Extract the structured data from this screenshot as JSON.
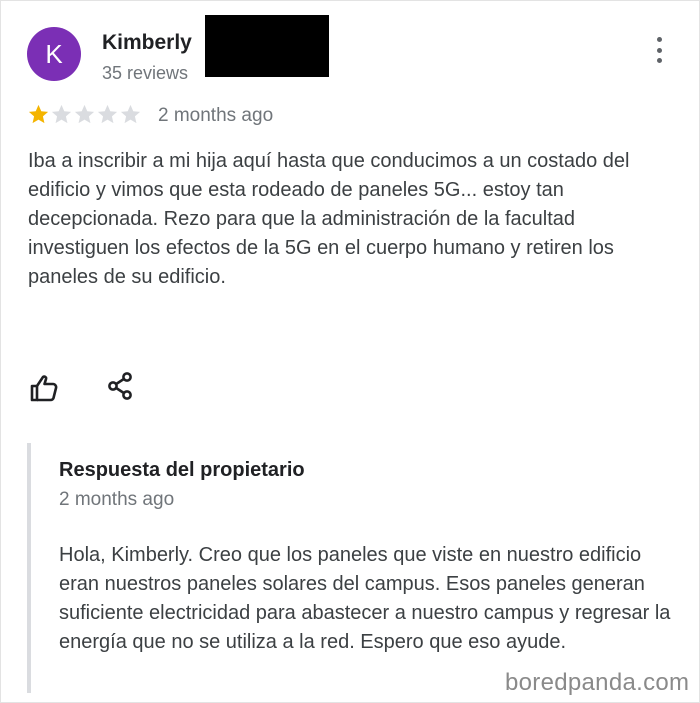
{
  "review": {
    "avatar_letter": "K",
    "avatar_color": "#7b2fb5",
    "author_name": "Kimberly",
    "author_meta": "35 reviews",
    "rating": 1,
    "rating_max": 5,
    "time": "2 months ago",
    "text": "Iba a inscribir a mi hija aquí hasta que conducimos a un costado del edificio y vimos que esta rodeado de paneles 5G... estoy tan decepcionada. Rezo para que la administración de la facultad investiguen los efectos de la 5G en el cuerpo humano y retiren los paneles de su edificio."
  },
  "actions": {
    "like_icon": "thumbs-up-icon",
    "share_icon": "share-icon",
    "more_icon": "more-vert-icon"
  },
  "owner_response": {
    "title": "Respuesta del propietario",
    "time": "2 months ago",
    "text": "Hola, Kimberly. Creo que los paneles que viste en nuestro edificio eran nuestros paneles solares del campus. Esos paneles generan suficiente electricidad para abastecer a nuestro campus y regresar la energía que no se utiliza a la red. Espero que eso ayude."
  },
  "watermark": "boredpanda.com",
  "colors": {
    "star_filled": "#f4b400",
    "star_empty": "#dadce0"
  }
}
